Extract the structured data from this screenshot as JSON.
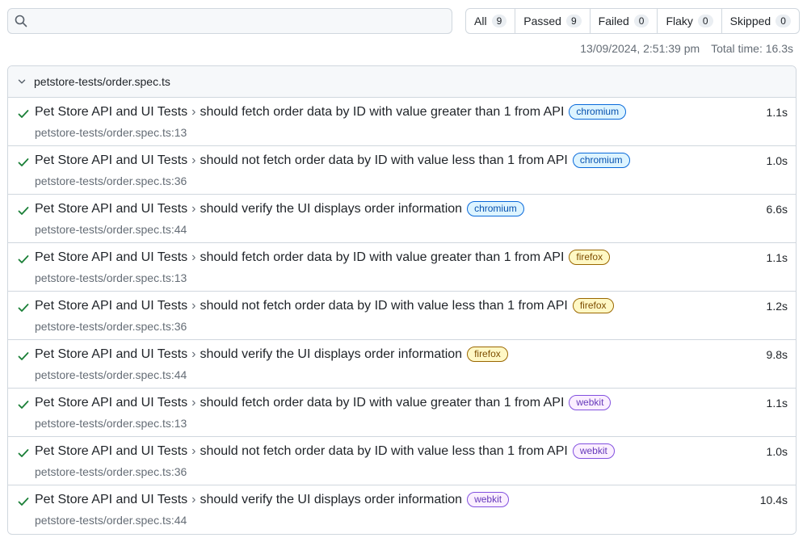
{
  "search": {
    "placeholder": ""
  },
  "filters": [
    {
      "label": "All",
      "count": "9"
    },
    {
      "label": "Passed",
      "count": "9"
    },
    {
      "label": "Failed",
      "count": "0"
    },
    {
      "label": "Flaky",
      "count": "0"
    },
    {
      "label": "Skipped",
      "count": "0"
    }
  ],
  "meta": {
    "timestamp": "13/09/2024, 2:51:39 pm",
    "total_time": "Total time: 16.3s"
  },
  "file": {
    "name": "petstore-tests/order.spec.ts"
  },
  "tests": [
    {
      "suite": "Pet Store API and UI Tests",
      "title": "should fetch order data by ID with value greater than 1 from API",
      "browser": "chromium",
      "location": "petstore-tests/order.spec.ts:13",
      "duration": "1.1s"
    },
    {
      "suite": "Pet Store API and UI Tests",
      "title": "should not fetch order data by ID with value less than 1 from API",
      "browser": "chromium",
      "location": "petstore-tests/order.spec.ts:36",
      "duration": "1.0s"
    },
    {
      "suite": "Pet Store API and UI Tests",
      "title": "should verify the UI displays order information",
      "browser": "chromium",
      "location": "petstore-tests/order.spec.ts:44",
      "duration": "6.6s"
    },
    {
      "suite": "Pet Store API and UI Tests",
      "title": "should fetch order data by ID with value greater than 1 from API",
      "browser": "firefox",
      "location": "petstore-tests/order.spec.ts:13",
      "duration": "1.1s"
    },
    {
      "suite": "Pet Store API and UI Tests",
      "title": "should not fetch order data by ID with value less than 1 from API",
      "browser": "firefox",
      "location": "petstore-tests/order.spec.ts:36",
      "duration": "1.2s"
    },
    {
      "suite": "Pet Store API and UI Tests",
      "title": "should verify the UI displays order information",
      "browser": "firefox",
      "location": "petstore-tests/order.spec.ts:44",
      "duration": "9.8s"
    },
    {
      "suite": "Pet Store API and UI Tests",
      "title": "should fetch order data by ID with value greater than 1 from API",
      "browser": "webkit",
      "location": "petstore-tests/order.spec.ts:13",
      "duration": "1.1s"
    },
    {
      "suite": "Pet Store API and UI Tests",
      "title": "should not fetch order data by ID with value less than 1 from API",
      "browser": "webkit",
      "location": "petstore-tests/order.spec.ts:36",
      "duration": "1.0s"
    },
    {
      "suite": "Pet Store API and UI Tests",
      "title": "should verify the UI displays order information",
      "browser": "webkit",
      "location": "petstore-tests/order.spec.ts:44",
      "duration": "10.4s"
    }
  ],
  "separator": "›",
  "icons": {
    "search": "search-icon",
    "expand": "chevron-down-icon",
    "pass": "check-icon"
  },
  "colors": {
    "pass": "#1a7f37",
    "border": "#d0d7de",
    "muted": "#656d76"
  }
}
